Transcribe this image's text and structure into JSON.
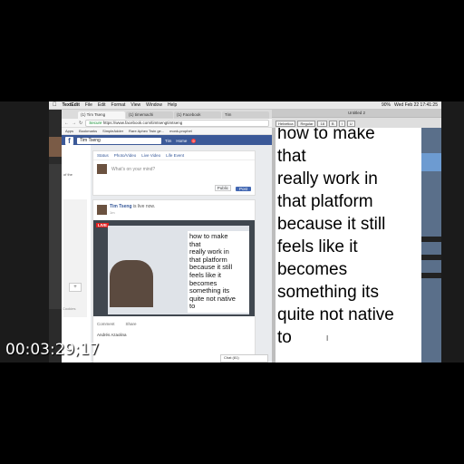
{
  "menubar": {
    "app_name": "TextEdit",
    "items": [
      "File",
      "Edit",
      "Format",
      "View",
      "Window",
      "Help"
    ],
    "clock": "Wed Feb 22  17:41:25",
    "battery": "90%"
  },
  "browser": {
    "tabs": [
      "(1) Tim Tseng",
      "(1) timemachi",
      "(1) Facebook",
      "Tim"
    ],
    "address": {
      "secure_label": "Secure",
      "url": "https://www.facebook.com/timtsengtimtseng"
    },
    "bookmarks": [
      "Apps",
      "Bookmarks",
      "SimpleAdder",
      "Rare Aphex Twin ge...",
      "monk-prophet"
    ]
  },
  "facebook": {
    "search_value": "Tim Tseng",
    "nav": {
      "profile": "Tim",
      "home": "Home",
      "notifications_count": "9"
    },
    "left_col": {
      "label": "of the",
      "cookie_text": "Cookies"
    },
    "composer": {
      "options": [
        "Status",
        "Photo/Video",
        "Live Video",
        "Life Event"
      ],
      "placeholder": "What's on your mind?",
      "privacy": "Public",
      "post_button": "Post"
    },
    "post": {
      "author": "Tim Tseng",
      "action": "is live now.",
      "meta": "1m",
      "live_badge": "LIVE",
      "video_text_lines": [
        "how to make",
        "that",
        "really work in",
        "that platform",
        "because it still",
        "feels like it",
        "becomes",
        "something its",
        "quite not native",
        "to"
      ],
      "actions": [
        "Comment",
        "Share"
      ],
      "commenter": "Andrés Azaolina"
    },
    "chat_label": "Chat (81)"
  },
  "editor": {
    "window_title": "Untitled 2",
    "toolbar": [
      "Helvetica",
      "Regular",
      "18",
      "B",
      "I",
      "U"
    ],
    "lines": [
      "how to make",
      "that",
      "really work in",
      "that platform",
      "because it still",
      "feels like it",
      "becomes",
      "something its",
      "quite not native",
      "to"
    ]
  },
  "overlay": {
    "timecode": "00:03:29;17"
  }
}
